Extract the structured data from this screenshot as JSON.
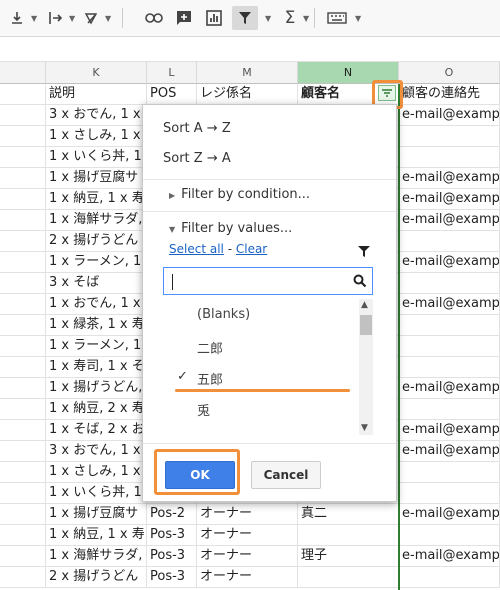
{
  "toolbar": {
    "icons": [
      "align-bottom-icon",
      "text-direction-icon",
      "text-rotate-icon",
      "link-icon",
      "insert-comment-icon",
      "insert-chart-icon",
      "filter-icon",
      "sigma-functions-icon",
      "keyboard-input-icon"
    ]
  },
  "columns": {
    "K": "K",
    "L": "L",
    "M": "M",
    "N": "N",
    "O": "O"
  },
  "headers": {
    "K": "説明",
    "L": "POS",
    "M": "レジ係名",
    "N": "顧客名",
    "O": "顧客の連絡先"
  },
  "rows": [
    {
      "k": "3 x おでん, 1 x",
      "l": "",
      "m": "",
      "n": "",
      "o": "e-mail@example"
    },
    {
      "k": "1 x さしみ, 1 x",
      "l": "",
      "m": "",
      "n": "",
      "o": ""
    },
    {
      "k": "1 x いくら丼, 1",
      "l": "",
      "m": "",
      "n": "",
      "o": ""
    },
    {
      "k": "1 x 揚げ豆腐サ",
      "l": "",
      "m": "",
      "n": "",
      "o": "e-mail@example"
    },
    {
      "k": "1 x 納豆, 1 x 寿",
      "l": "",
      "m": "",
      "n": "",
      "o": "e-mail@example"
    },
    {
      "k": "1 x 海鮮サラダ,",
      "l": "",
      "m": "",
      "n": "",
      "o": "e-mail@example"
    },
    {
      "k": "2 x 揚げうどん",
      "l": "",
      "m": "",
      "n": "",
      "o": ""
    },
    {
      "k": "1 x ラーメン, 1",
      "l": "",
      "m": "",
      "n": "",
      "o": "e-mail@example"
    },
    {
      "k": "3 x そば",
      "l": "",
      "m": "",
      "n": "",
      "o": ""
    },
    {
      "k": "1 x おでん, 1 x",
      "l": "",
      "m": "",
      "n": "",
      "o": "e-mail@example"
    },
    {
      "k": "1 x 緑茶, 1 x 寿",
      "l": "",
      "m": "",
      "n": "",
      "o": ""
    },
    {
      "k": "1 x ラーメン, 1",
      "l": "",
      "m": "",
      "n": "",
      "o": ""
    },
    {
      "k": "1 x 寿司, 1 x そ",
      "l": "",
      "m": "",
      "n": "",
      "o": ""
    },
    {
      "k": "1 x 揚げうどん,",
      "l": "",
      "m": "",
      "n": "",
      "o": "e-mail@example"
    },
    {
      "k": "1 x 納豆, 2 x 寿",
      "l": "",
      "m": "",
      "n": "",
      "o": ""
    },
    {
      "k": "1 x そば, 2 x お",
      "l": "",
      "m": "",
      "n": "",
      "o": "e-mail@example"
    },
    {
      "k": "3 x おでん, 1 x",
      "l": "",
      "m": "",
      "n": "",
      "o": "e-mail@example"
    },
    {
      "k": "1 x さしみ, 1 x",
      "l": "",
      "m": "",
      "n": "",
      "o": ""
    },
    {
      "k": "1 x いくら丼, 1",
      "l": "",
      "m": "",
      "n": "",
      "o": ""
    },
    {
      "k": "1 x 揚げ豆腐サ",
      "l": "Pos-2",
      "m": "オーナー",
      "n": "真二",
      "o": "e-mail@example"
    },
    {
      "k": "1 x 納豆, 1 x 寿",
      "l": "Pos-3",
      "m": "オーナー",
      "n": "",
      "o": ""
    },
    {
      "k": "1 x 海鮮サラダ,",
      "l": "Pos-3",
      "m": "オーナー",
      "n": "理子",
      "o": "e-mail@example"
    },
    {
      "k": "2 x 揚げうどん",
      "l": "Pos-3",
      "m": "オーナー",
      "n": "",
      "o": ""
    }
  ],
  "filter_menu": {
    "sort_az": "Sort A → Z",
    "sort_za": "Sort Z → A",
    "by_condition": "Filter by condition...",
    "by_values": "Filter by values...",
    "select_all": "Select all",
    "separator": "-",
    "clear": "Clear",
    "search_value": "",
    "values": [
      {
        "label": "(Blanks)",
        "checked": false
      },
      {
        "label": "二郎",
        "checked": false
      },
      {
        "label": "五郎",
        "checked": true
      },
      {
        "label": "兎",
        "checked": false
      }
    ],
    "ok": "OK",
    "cancel": "Cancel"
  },
  "colors": {
    "accent": "#3e7fe8",
    "highlight": "#f28f3b",
    "selected_column": "#a8d8b0"
  }
}
